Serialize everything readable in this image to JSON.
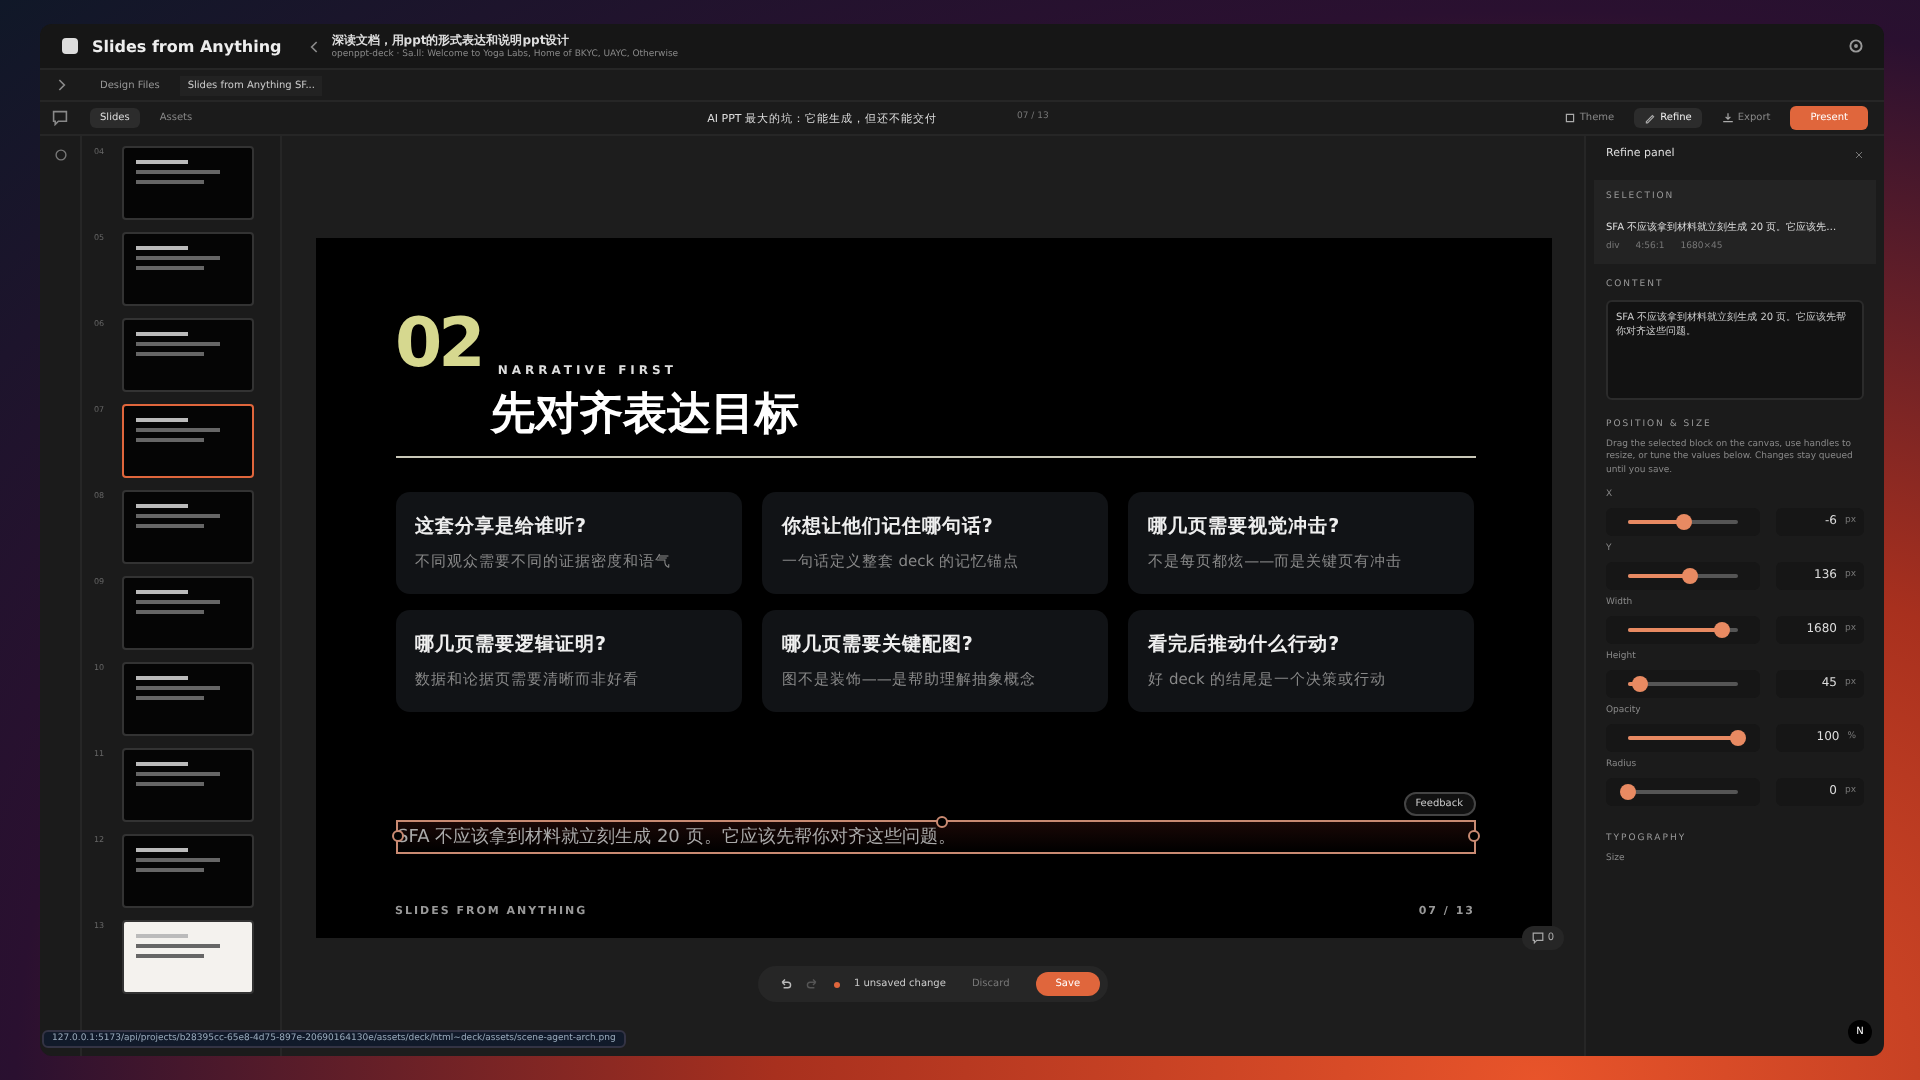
{
  "app": {
    "name": "Slides from Anything",
    "title": "深读文档，用ppt的形式表达和说明ppt设计",
    "subtitle": "openppt-deck · Sa.ll: Welcome to Yoga Labs, Home of BKYC, UAYC, Otherwise"
  },
  "breadcrumbs": [
    {
      "label": "Design Files",
      "selected": false
    },
    {
      "label": "Slides from Anything SF...",
      "selected": true
    }
  ],
  "view_tabs": [
    {
      "label": "Slides",
      "selected": true
    },
    {
      "label": "Assets",
      "selected": false
    }
  ],
  "deck_title": "AI PPT 最大的坑：它能生成，但还不能交付",
  "page_counter": "07 / 13",
  "actions": [
    {
      "label": "Theme",
      "kind": "theme",
      "selected": false
    },
    {
      "label": "Refine",
      "kind": "refine",
      "selected": true
    },
    {
      "label": "Export",
      "kind": "export",
      "selected": false
    }
  ],
  "present": {
    "label": "Present"
  },
  "thumbnails": [
    {
      "number": "04",
      "kind": "dark",
      "selected": false
    },
    {
      "number": "05",
      "kind": "dark",
      "selected": false
    },
    {
      "number": "06",
      "kind": "dark",
      "selected": false
    },
    {
      "number": "07",
      "kind": "dark",
      "selected": true
    },
    {
      "number": "08",
      "kind": "dark",
      "selected": false
    },
    {
      "number": "09",
      "kind": "dark",
      "selected": false
    },
    {
      "number": "10",
      "kind": "dark",
      "selected": false
    },
    {
      "number": "11",
      "kind": "dark",
      "selected": false
    },
    {
      "number": "12",
      "kind": "dark",
      "selected": false
    },
    {
      "number": "13",
      "kind": "light",
      "selected": false
    }
  ],
  "slide": {
    "number": "02",
    "eyebrow": "NARRATIVE FIRST",
    "title": "先对齐表达目标",
    "cards": [
      {
        "title": "这套分享是给谁听?",
        "text": "不同观众需要不同的证据密度和语气"
      },
      {
        "title": "你想让他们记住哪句话?",
        "text": "一句话定义整套 deck 的记忆锚点"
      },
      {
        "title": "哪几页需要视觉冲击?",
        "text": "不是每页都炫——而是关键页有冲击"
      },
      {
        "title": "哪几页需要逻辑证明?",
        "text": "数据和论据页需要清晰而非好看"
      },
      {
        "title": "哪几页需要关键配图?",
        "text": "图不是装饰——是帮助理解抽象概念"
      },
      {
        "title": "看完后推动什么行动?",
        "text": "好 deck 的结尾是一个决策或行动"
      }
    ],
    "selected_text": "SFA 不应该拿到材料就立刻生成 20 页。它应该先帮你对齐这些问题。",
    "feedback": "Feedback",
    "footer": "SLIDES FROM ANYTHING",
    "page": "07 / 13"
  },
  "bottom_bar": {
    "status": "1 unsaved change",
    "discard": "Discard",
    "save": "Save",
    "comments": "0"
  },
  "status_url": "127.0.0.1:5173/api/projects/b28395cc-65e8-4d75-897e-20690164130e/assets/deck/html~deck/assets/scene-agent-arch.png",
  "panel": {
    "title": "Refine panel",
    "selection_heading": "SELECTION",
    "selection_text": "SFA 不应该拿到材料就立刻生成 20 页。它应该先…",
    "selection_meta": [
      "div",
      "4:56:1",
      "1680×45"
    ],
    "content_heading": "CONTENT",
    "content_value": "SFA 不应该拿到材料就立刻生成 20 页。它应该先帮你对齐这些问题。",
    "position_heading": "POSITION & SIZE",
    "hint": "Drag the selected block on the canvas, use handles to resize, or tune the values below. Changes stay queued until you save.",
    "fields": [
      {
        "label": "X",
        "value": "-6",
        "unit": "px",
        "level": 0.5
      },
      {
        "label": "Y",
        "value": "136",
        "unit": "px",
        "level": 0.56
      },
      {
        "label": "Width",
        "value": "1680",
        "unit": "px",
        "level": 0.86
      },
      {
        "label": "Height",
        "value": "45",
        "unit": "px",
        "level": 0.1
      },
      {
        "label": "Opacity",
        "value": "100",
        "unit": "%",
        "level": 1
      },
      {
        "label": "Radius",
        "value": "0",
        "unit": "px",
        "level": 0
      }
    ],
    "typography_heading": "TYPOGRAPHY",
    "size_label": "Size"
  },
  "avatar": "N"
}
